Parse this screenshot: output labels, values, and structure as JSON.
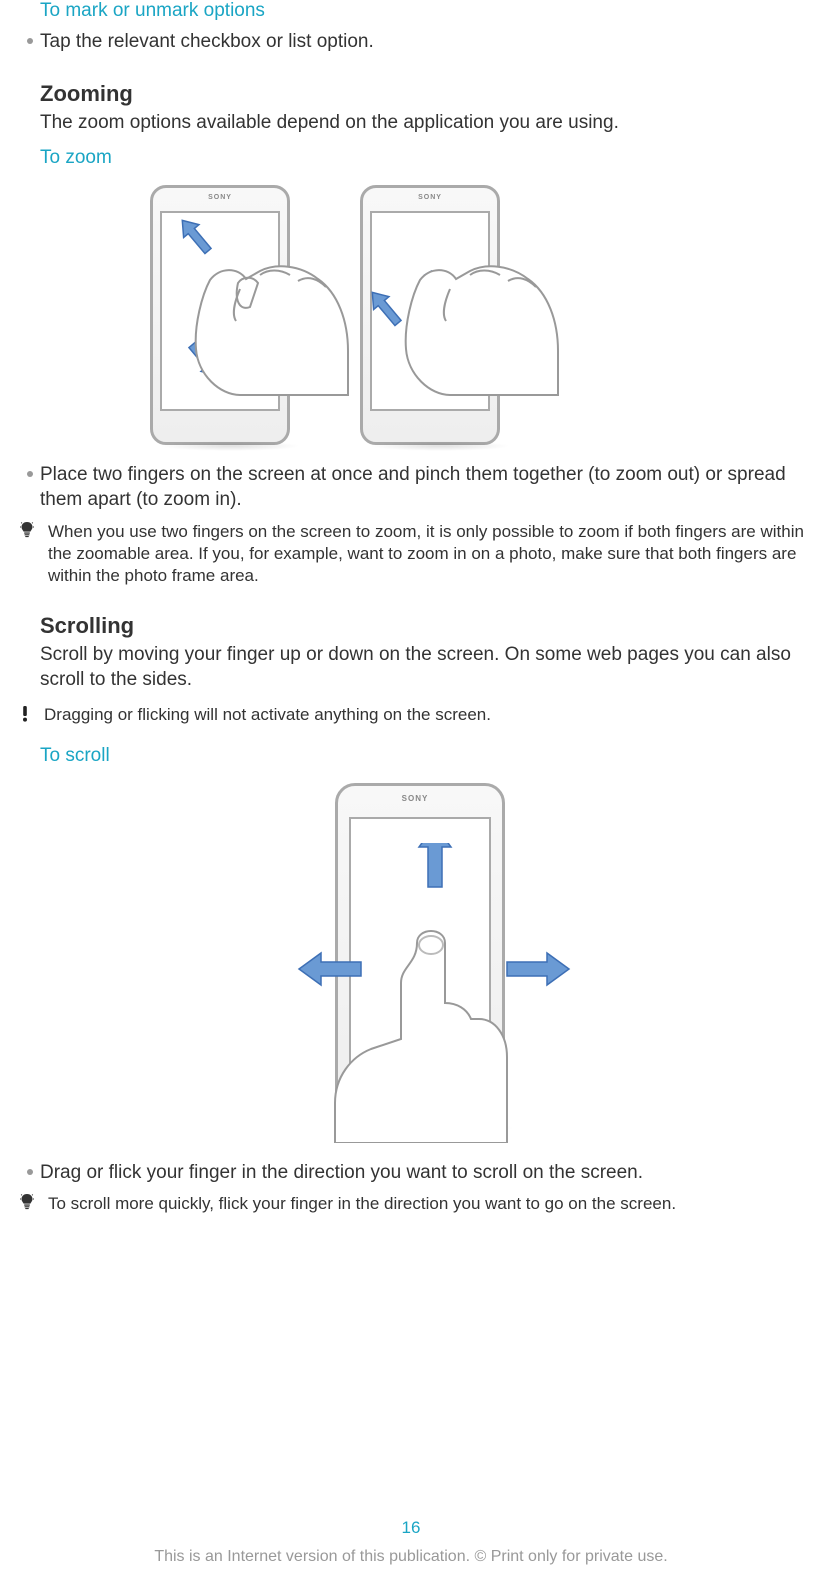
{
  "s1": {
    "heading": "To mark or unmark options",
    "bullet": "Tap the relevant checkbox or list option."
  },
  "zoom": {
    "heading": "Zooming",
    "desc": "The zoom options available depend on the application you are using.",
    "sub": "To zoom",
    "brand": "SONY",
    "bullet": "Place two fingers on the screen at once and pinch them together (to zoom out) or spread them apart (to zoom in).",
    "tip": "When you use two fingers on the screen to zoom, it is only possible to zoom if both fingers are within the zoomable area. If you, for example, want to zoom in on a photo, make sure that both fingers are within the photo frame area."
  },
  "scroll": {
    "heading": "Scrolling",
    "desc": "Scroll by moving your finger up or down on the screen. On some web pages you can also scroll to the sides.",
    "note": "Dragging or flicking will not activate anything on the screen.",
    "sub": "To scroll",
    "brand": "SONY",
    "bullet": "Drag or flick your finger in the direction you want to scroll on the screen.",
    "tip": "To scroll more quickly, flick your finger in the direction you want to go on the screen."
  },
  "page": "16",
  "footer": "This is an Internet version of this publication. © Print only for private use."
}
